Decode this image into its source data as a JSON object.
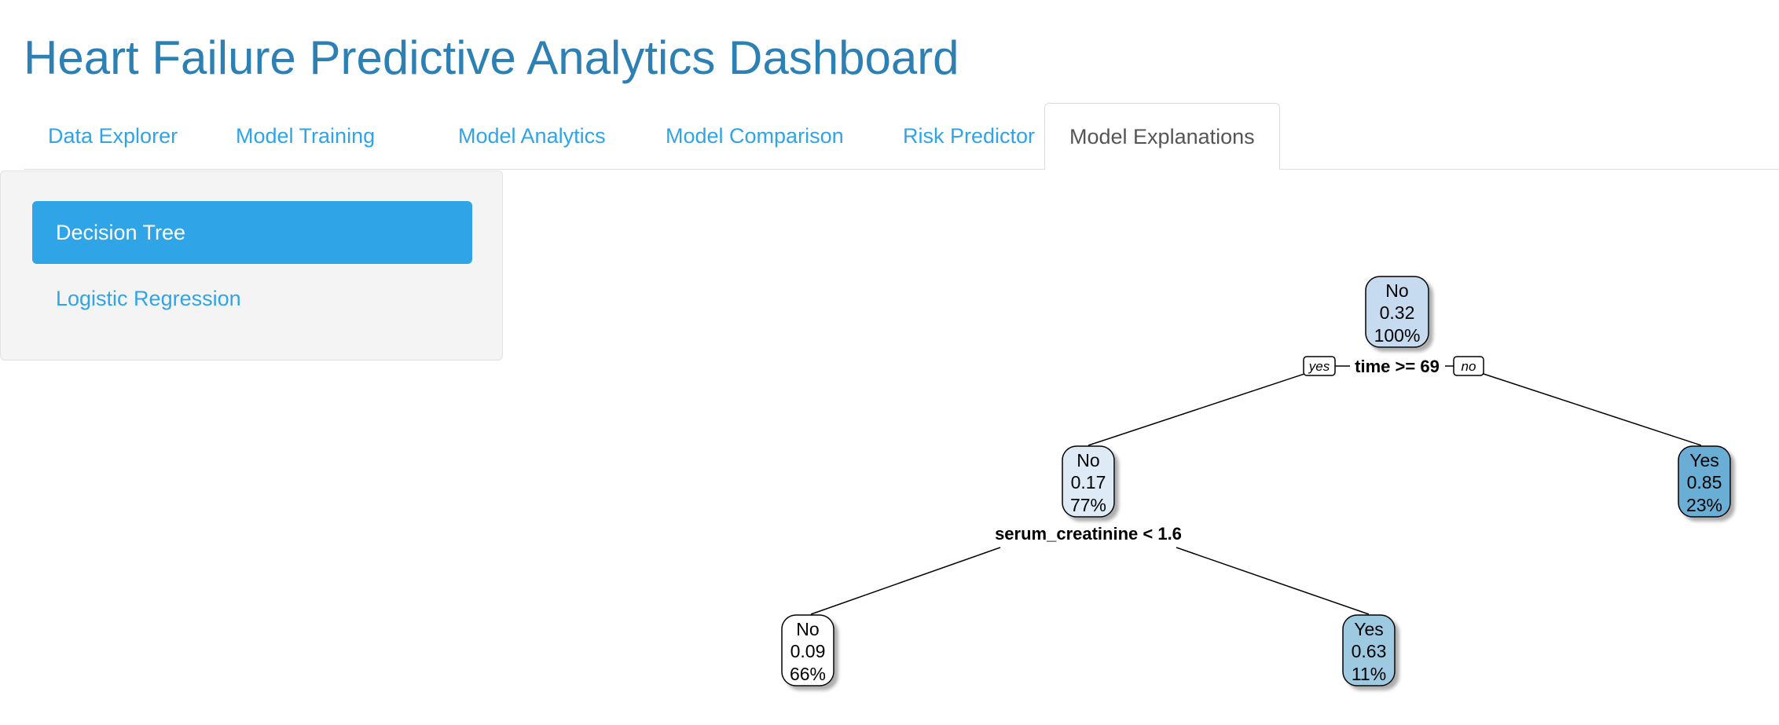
{
  "app": {
    "title": "Heart Failure Predictive Analytics Dashboard"
  },
  "tabs": [
    {
      "label": "Data Explorer",
      "active": false
    },
    {
      "label": "Model Training",
      "active": false
    },
    {
      "label": "Model Analytics",
      "active": false
    },
    {
      "label": "Model Comparison",
      "active": false
    },
    {
      "label": "Risk Predictor",
      "active": false
    },
    {
      "label": "Model Explanations",
      "active": true
    }
  ],
  "sidebar": {
    "pills": [
      {
        "label": "Decision Tree",
        "active": true
      },
      {
        "label": "Logistic Regression",
        "active": false
      }
    ]
  },
  "tree": {
    "nodes": [
      {
        "id": "root",
        "class": "No",
        "prob": "0.32",
        "pct": "100%",
        "fill": "#c6dbef"
      },
      {
        "id": "left",
        "class": "No",
        "prob": "0.17",
        "pct": "77%",
        "fill": "#deebf7"
      },
      {
        "id": "right",
        "class": "Yes",
        "prob": "0.85",
        "pct": "23%",
        "fill": "#6baed6"
      },
      {
        "id": "left-left",
        "class": "No",
        "prob": "0.09",
        "pct": "66%",
        "fill": "#ffffff"
      },
      {
        "id": "left-right",
        "class": "Yes",
        "prob": "0.63",
        "pct": "11%",
        "fill": "#9ecae1"
      }
    ],
    "splits": {
      "root": "time >= 69",
      "left": "serum_creatinine < 1.6"
    },
    "branch_labels": {
      "yes": "yes",
      "no": "no"
    }
  },
  "colors": {
    "accent": "#2fa4e7",
    "title": "#2c80b4"
  }
}
